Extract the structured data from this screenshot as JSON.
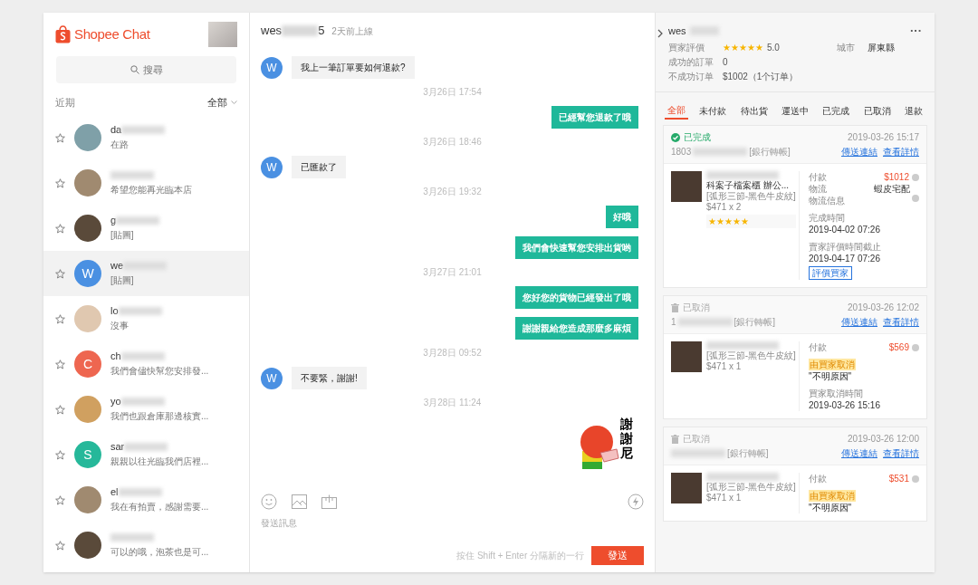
{
  "sidebar": {
    "logo": "Shopee Chat",
    "search": {
      "label": "搜尋"
    },
    "section": "近期",
    "filter": "全部",
    "contacts": [
      {
        "name": "da",
        "preview": "在路",
        "selected": false
      },
      {
        "preview": "希望您能再光臨本店",
        "selected": false
      },
      {
        "name": "g",
        "preview": "[貼圖]",
        "selected": false
      },
      {
        "name": "we",
        "preview": "[貼圖]",
        "letter": "W",
        "color": "#4a90e2",
        "selected": true
      },
      {
        "name": "lo",
        "preview": "沒事",
        "selected": false
      },
      {
        "name": "ch",
        "preview": "我們會儘快幫您安排發...",
        "letter": "C",
        "color": "#ee6650",
        "selected": false
      },
      {
        "name": "yo",
        "preview": "我們也跟倉庫那邊核實...",
        "selected": false
      },
      {
        "name": "sar",
        "preview": "親親以往光臨我們店裡...",
        "letter": "S",
        "color": "#26b89a",
        "selected": false
      },
      {
        "name": "el",
        "preview": "我在有拍賣，感謝需要...",
        "selected": false
      },
      {
        "preview": "可以的哦，泡茶也是可...",
        "selected": false
      }
    ]
  },
  "chat": {
    "name_start": "wes",
    "name_end": "5",
    "last_seen": "2天前上線",
    "messages": [
      {
        "kind": "in",
        "avatar": "W",
        "text": "我上一筆訂單要如何退款?"
      },
      {
        "kind": "time",
        "text": "3月26日 17:54"
      },
      {
        "kind": "out",
        "text": "已經幫您退款了哦"
      },
      {
        "kind": "time",
        "text": "3月26日 18:46"
      },
      {
        "kind": "in",
        "avatar": "W",
        "text": "已匯款了"
      },
      {
        "kind": "time",
        "text": "3月26日 19:32"
      },
      {
        "kind": "out",
        "text": "好哦"
      },
      {
        "kind": "out",
        "text": "我們會快速幫您安排出貨哟"
      },
      {
        "kind": "time",
        "text": "3月27日 21:01"
      },
      {
        "kind": "out",
        "text": "您好您的貨物已經發出了哦"
      },
      {
        "kind": "out",
        "text": "謝謝親給您造成那麼多麻煩"
      },
      {
        "kind": "time",
        "text": "3月28日 09:52"
      },
      {
        "kind": "in",
        "avatar": "W",
        "text": "不要緊，謝謝!"
      },
      {
        "kind": "time",
        "text": "3月28日 11:24"
      },
      {
        "kind": "sticker",
        "text": "謝謝尼"
      }
    ],
    "composer": {
      "placeholder": "發送訊息",
      "hint": "按住 Shift + Enter 分隔新的一行",
      "send": "發送"
    }
  },
  "buyer": {
    "name": "wes",
    "more": "···",
    "rating_label": "買家評價",
    "stars": 5,
    "rating": "5.0",
    "city_label": "城市",
    "city": "屏東縣",
    "success_label": "成功的訂單",
    "success": "0",
    "failed_label": "不成功订单",
    "failed": "$1002（1个订单）"
  },
  "order_tabs": [
    {
      "label": "全部",
      "selected": true
    },
    {
      "label": "未付款",
      "selected": false
    },
    {
      "label": "待出貨",
      "selected": false
    },
    {
      "label": "運送中",
      "selected": false
    },
    {
      "label": "已完成",
      "selected": false
    },
    {
      "label": "已取消",
      "selected": false
    },
    {
      "label": "退款",
      "selected": false
    }
  ],
  "orders": [
    {
      "status": "已完成",
      "kind": "completed",
      "time": "2019-03-26 15:17",
      "id_start": "1803",
      "payment_method": "[銀行轉帳]",
      "links": [
        "傳送連結",
        "查看詳情"
      ],
      "product": {
        "title": "科案子檔案櫃 辦公...",
        "variant": "[弧形三節-黑色牛皮紋]",
        "price": "$471 x 2",
        "stars": 5
      },
      "pay_label": "付款",
      "pay": "$1012",
      "details": [
        {
          "label": "物流",
          "value": "蝦皮宅配"
        },
        {
          "label": "物流信息"
        }
      ],
      "times": [
        {
          "label": "完成時間",
          "value": "2019-04-02 07:26"
        },
        {
          "label": "賣家評價時間截止",
          "value": "2019-04-17 07:26"
        }
      ],
      "action": "評價買家"
    },
    {
      "status": "已取消",
      "kind": "cancelled",
      "time": "2019-03-26 12:02",
      "id_start": "1",
      "payment_method": "[銀行轉帳]",
      "links": [
        "傳送連結",
        "查看詳情"
      ],
      "product": {
        "variant": "[弧形三節-黑色牛皮紋]",
        "price": "$471 x 1"
      },
      "pay_label": "付款",
      "pay": "$569",
      "cancel_badge": "由買家取消",
      "reason": "\"不明原因\"",
      "times": [
        {
          "label": "買家取消時間",
          "value": "2019-03-26 15:16"
        }
      ]
    },
    {
      "status": "已取消",
      "kind": "cancelled",
      "time": "2019-03-26 12:00",
      "payment_method": "[銀行轉帳]",
      "links": [
        "傳送連結",
        "查看詳情"
      ],
      "product": {
        "variant": "[弧形三節-黑色牛皮紋]",
        "price": "$471 x 1"
      },
      "pay_label": "付款",
      "pay": "$531",
      "cancel_badge": "由買家取消",
      "reason": "\"不明原因\""
    }
  ]
}
